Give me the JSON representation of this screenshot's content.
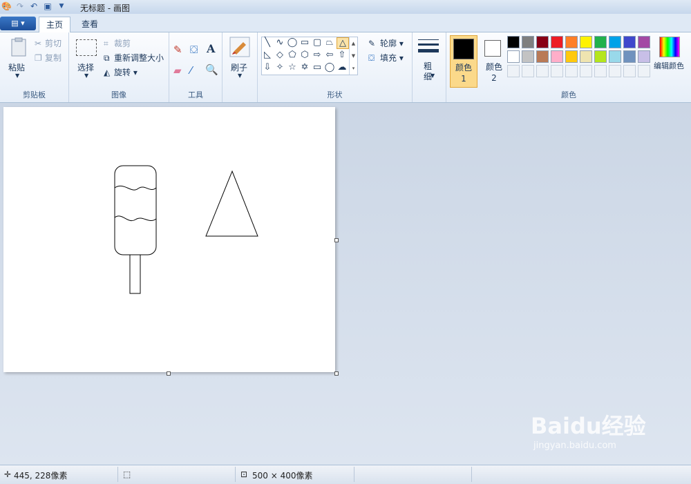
{
  "window": {
    "title": "无标题 - 画图"
  },
  "tabs": {
    "home": "主页",
    "view": "查看"
  },
  "clipboard": {
    "paste": "粘贴",
    "cut": "剪切",
    "copy": "复制",
    "label": "剪贴板"
  },
  "image": {
    "select": "选择",
    "crop": "裁剪",
    "resize": "重新调整大小",
    "rotate": "旋转",
    "label": "图像"
  },
  "tools": {
    "label": "工具"
  },
  "brush": {
    "label": "刷子"
  },
  "shapes": {
    "outline": "轮廓",
    "fill": "填充",
    "label": "形状"
  },
  "size": {
    "label": "粗细"
  },
  "colors": {
    "color1": "颜色 1",
    "color2": "颜色 2",
    "edit": "编辑颜色",
    "label": "颜色",
    "color1_value": "#000000",
    "color2_value": "#ffffff",
    "palette_row1": [
      "#000000",
      "#7f7f7f",
      "#880015",
      "#ed1c24",
      "#ff7f27",
      "#fff200",
      "#22b14c",
      "#00a2e8",
      "#3f48cc",
      "#a349a4"
    ],
    "palette_row2": [
      "#ffffff",
      "#c3c3c3",
      "#b97a57",
      "#ffaec9",
      "#ffc90e",
      "#efe4b0",
      "#b5e61d",
      "#99d9ea",
      "#7092be",
      "#c8bfe7"
    ]
  },
  "status": {
    "cursor": "445, 228像素",
    "canvas_size": "500 × 400像素"
  },
  "watermark": {
    "logo": "Baidu经验",
    "url": "jingyan.baidu.com"
  }
}
